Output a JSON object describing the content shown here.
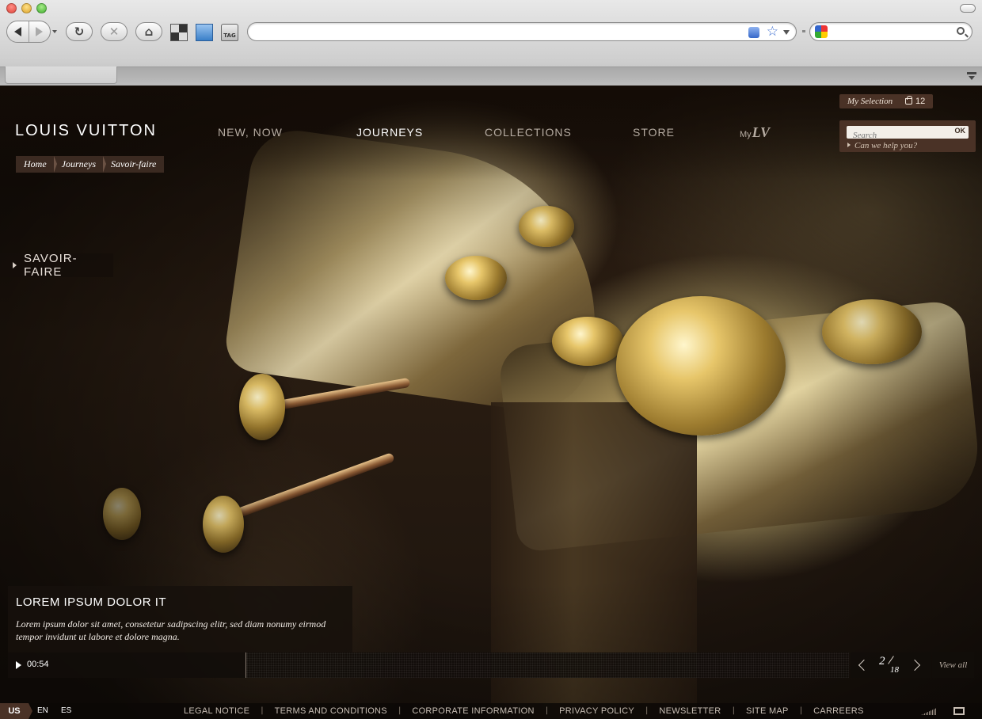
{
  "browser": {
    "tag_icon_label": "TAG"
  },
  "site": {
    "logo": "LOUIS VUITTON",
    "nav": [
      {
        "label": "NEW, NOW"
      },
      {
        "label": "JOURNEYS",
        "active": true
      },
      {
        "label": "COLLECTIONS"
      },
      {
        "label": "STORE"
      }
    ],
    "my_lv": {
      "prefix": "My",
      "mono": "LV"
    },
    "my_selection": {
      "label": "My Selection",
      "count": "12"
    },
    "search": {
      "placeholder": "Search",
      "ok_label": "OK",
      "help": "Can we help you?"
    }
  },
  "breadcrumb": [
    "Home",
    "Journeys",
    "Savoir-faire"
  ],
  "section_tag": "SAVOIR-FAIRE",
  "caption": {
    "title": "LOREM IPSUM DOLOR IT",
    "text": "Lorem ipsum dolor sit amet, consetetur sadipscing elitr, sed diam nonumy eirmod tempor invidunt ut labore et dolore magna."
  },
  "player": {
    "time": "00:54"
  },
  "pager": {
    "current": "2",
    "total": "18",
    "view_all": "View all"
  },
  "footer": {
    "languages": [
      "US",
      "EN",
      "ES"
    ],
    "links": [
      "LEGAL NOTICE",
      "TERMS AND CONDITIONS",
      "CORPORATE INFORMATION",
      "PRIVACY POLICY",
      "NEWSLETTER",
      "SITE MAP",
      "CARREERS"
    ]
  },
  "colors": {
    "accent_brown": "#4a3226",
    "breadcrumb_bg": "#3b2a21",
    "nav_inactive": "#b6aca2",
    "nav_active": "#ffffff"
  }
}
